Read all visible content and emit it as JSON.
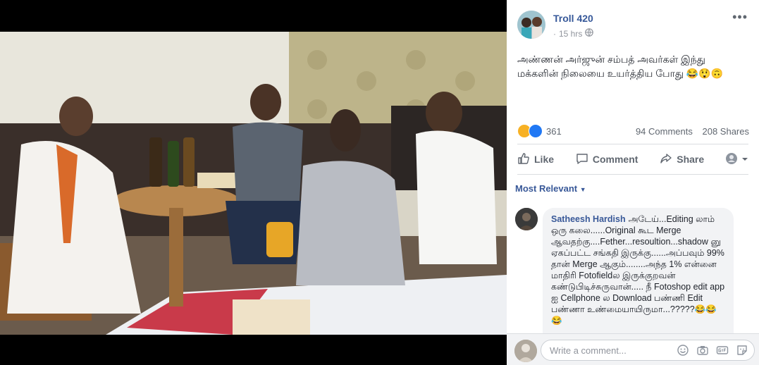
{
  "post": {
    "author": "Troll 420",
    "time": "15 hrs",
    "text": "அண்ணன் அர்ஜுன் சம்பத் அவர்கள் இந்து மக்களின் நிலையை உயர்த்திய போது 😂😲🙃",
    "reaction_count": "361",
    "comments_count": "94 Comments",
    "shares_count": "208 Shares",
    "privacy_icon": "globe-icon"
  },
  "actions": {
    "like": "Like",
    "comment": "Comment",
    "share": "Share"
  },
  "comments_filter": "Most Relevant",
  "comments": [
    {
      "author": "Satheesh Hardish",
      "text": "அடேய்...Editing லாம் ஒரு கலை......Original கூட Merge ஆவதற்கு....Fether...resoultion...shadow னு ஏகப்பட்ட சங்கதி இருக்கு......அப்பவும் 99% தான் Merge ஆகும்........அந்த 1% என்னை மாதிரி Fotofieldல இருக்குறவன் கண்டுபிடிச்சுருவான்..... நீ Fotoshop edit app ஐ Cellphone ல Download பண்ணி Edit பண்ணா உண்மையாயிருமா...?????😂😂😂"
    }
  ],
  "composer": {
    "placeholder": "Write a comment..."
  },
  "colors": {
    "link": "#365899",
    "like_blue": "#2078f4",
    "haha_yellow": "#f7b125",
    "photo_bg": "#000000"
  }
}
